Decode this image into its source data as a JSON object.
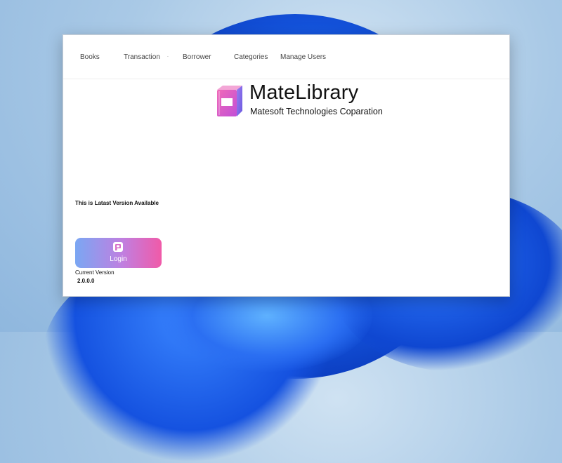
{
  "menu": {
    "items": [
      {
        "label": "Books"
      },
      {
        "label": "Transaction"
      },
      {
        "label": "Borrower"
      },
      {
        "label": "Categories"
      },
      {
        "label": "Manage Users"
      }
    ],
    "separator": "·"
  },
  "header": {
    "logo_icon": "book-icon",
    "title": "MateLibrary",
    "subtitle": "Matesoft Technologies Coparation"
  },
  "update": {
    "message": "This is Latast Version Available"
  },
  "login": {
    "icon": "login-icon",
    "label": "Login"
  },
  "version": {
    "label": "Current Version",
    "value": "2.0.0.0"
  },
  "colors": {
    "login_gradient_start": "#7aa7f3",
    "login_gradient_end": "#f05aa8",
    "logo_primary": "#e64fa3",
    "logo_secondary": "#8b6fe6"
  }
}
